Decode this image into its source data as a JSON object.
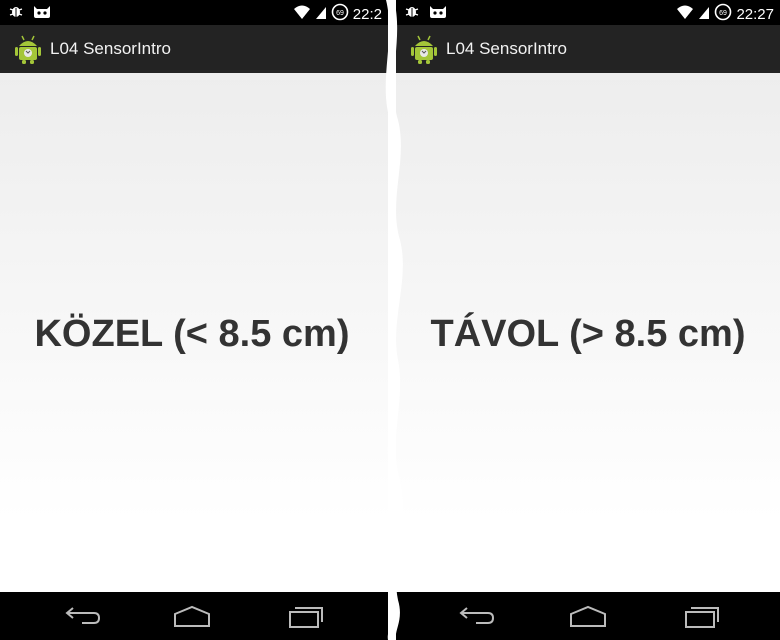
{
  "colors": {
    "status_bar": "#000000",
    "action_bar": "#232323",
    "nav_bar": "#000000",
    "main_text": "#333333",
    "android_green": "#a4c639"
  },
  "screens": [
    {
      "status": {
        "time": "22:2",
        "battery": "69"
      },
      "app_title": "L04 SensorIntro",
      "main_text": "KÖZEL (< 8.5 cm)"
    },
    {
      "status": {
        "time": "22:27",
        "battery": "69"
      },
      "app_title": "L04 SensorIntro",
      "main_text": "TÁVOL (> 8.5 cm)"
    }
  ]
}
